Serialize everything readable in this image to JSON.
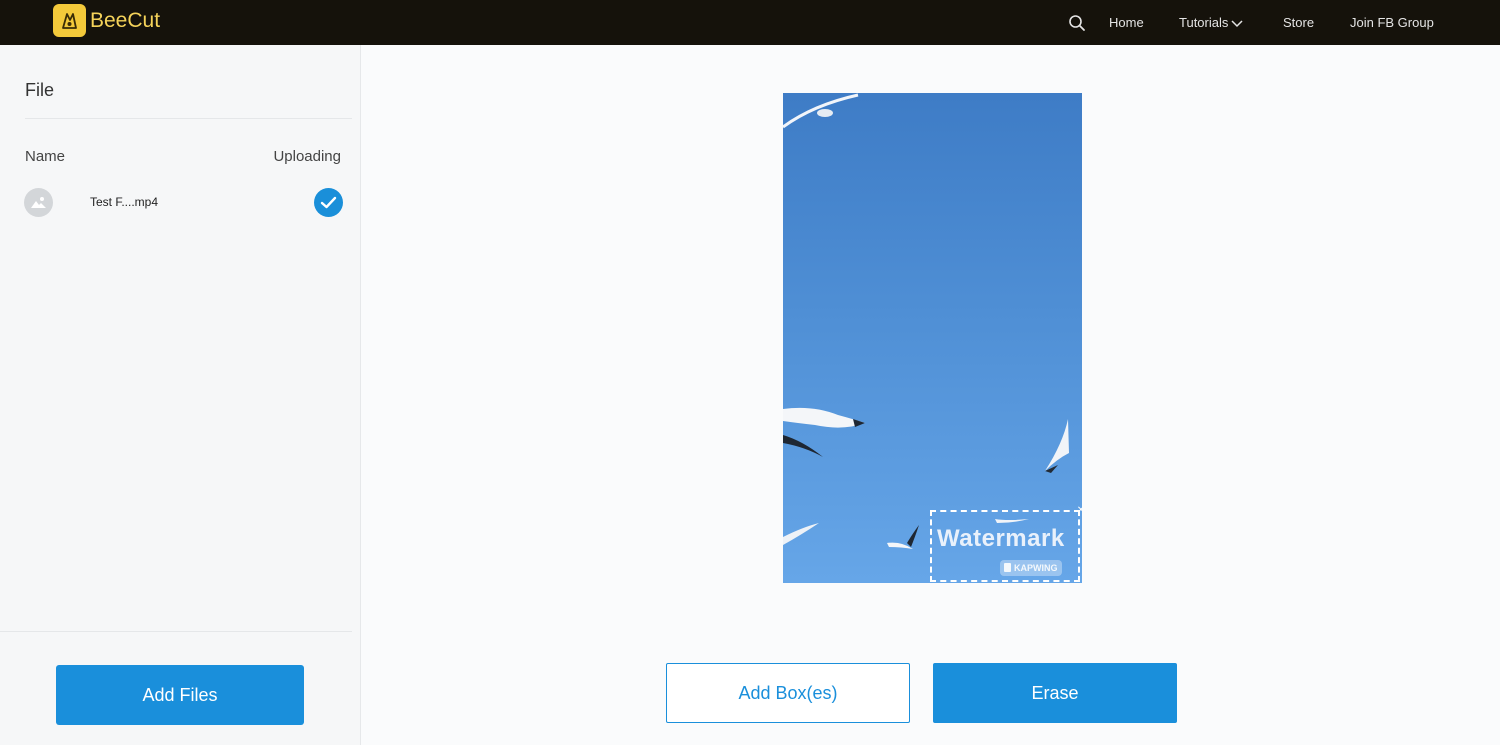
{
  "header": {
    "brand": "BeeCut",
    "nav": {
      "home": "Home",
      "tutorials": "Tutorials",
      "store": "Store",
      "fb_group": "Join FB Group"
    }
  },
  "sidebar": {
    "title": "File",
    "columns": {
      "name": "Name",
      "status": "Uploading"
    },
    "files": [
      {
        "name": "Test F....mp4",
        "status_icon": "check-icon"
      }
    ],
    "add_files_label": "Add Files"
  },
  "preview": {
    "watermark_text": "Watermark",
    "watermark_badge": "KAPWING"
  },
  "actions": {
    "add_boxes_label": "Add Box(es)",
    "erase_label": "Erase"
  },
  "colors": {
    "topbar": "#15120b",
    "brand": "#f5d35a",
    "accent": "#1a8fdb",
    "sky": "#4f8fd5"
  }
}
